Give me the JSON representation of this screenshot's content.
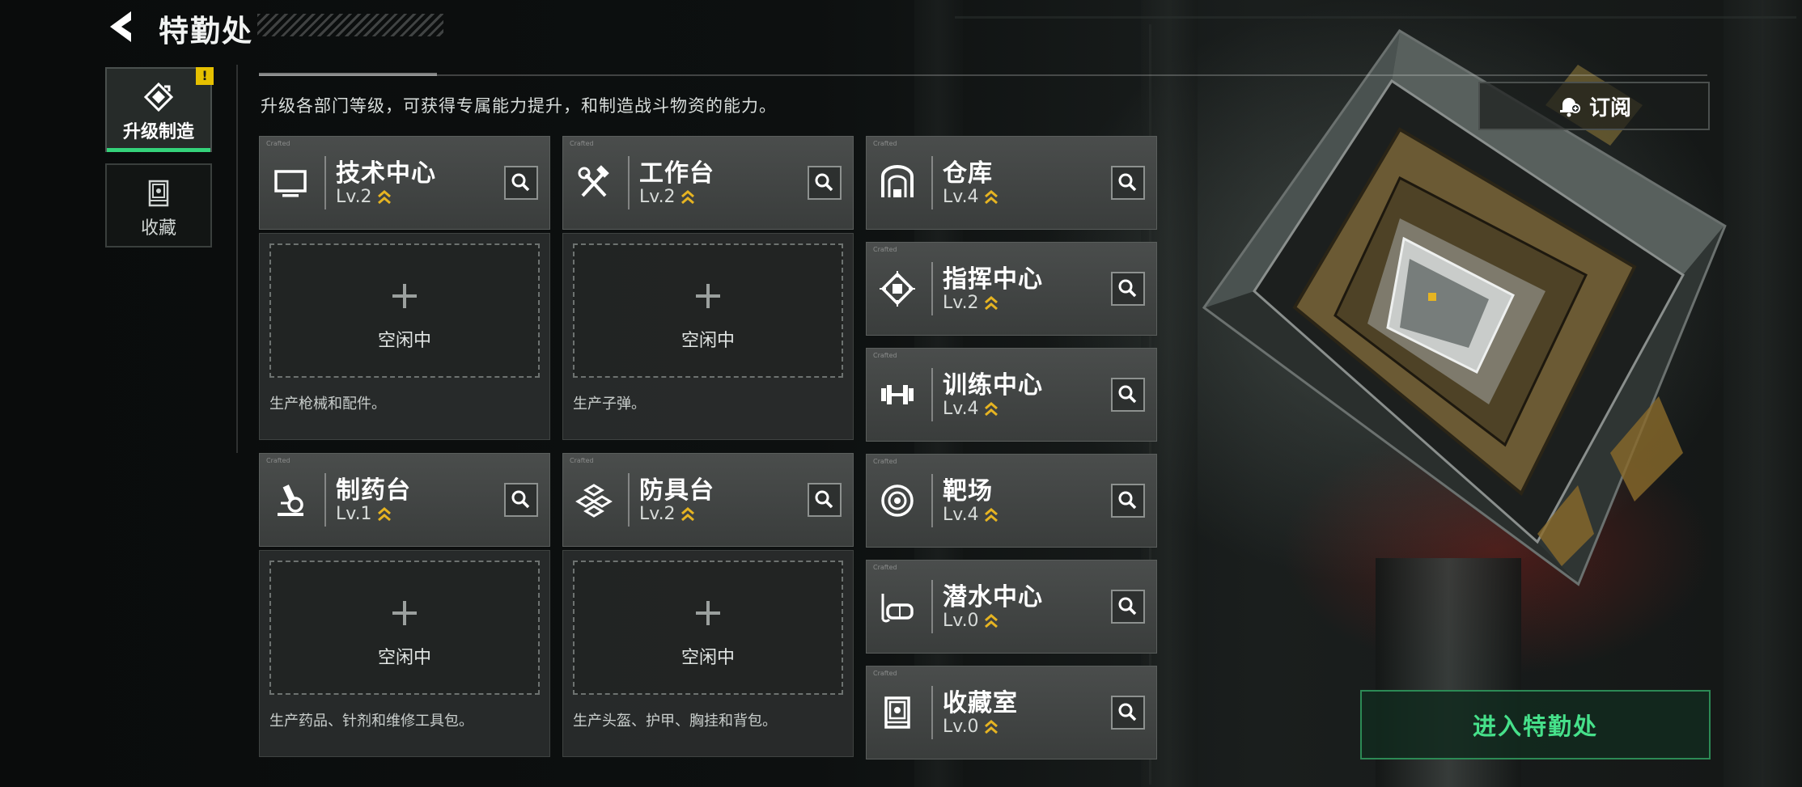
{
  "header": {
    "title": "特勤处"
  },
  "tabs": [
    {
      "label": "升级制造",
      "active": true,
      "alert": "!"
    },
    {
      "label": "收藏",
      "active": false
    }
  ],
  "description": "升级各部门等级，可获得专属能力提升，和制造战斗物资的能力。",
  "subscribe": {
    "label": "订阅"
  },
  "enter": {
    "label": "进入特勤处"
  },
  "idle_label": "空闲中",
  "departments": {
    "tech_center": {
      "name": "技术中心",
      "level": "Lv.2",
      "produce": "生产枪械和配件。"
    },
    "workbench": {
      "name": "工作台",
      "level": "Lv.2",
      "produce": "生产子弹。"
    },
    "pharmacy": {
      "name": "制药台",
      "level": "Lv.1",
      "produce": "生产药品、针剂和维修工具包。"
    },
    "armor": {
      "name": "防具台",
      "level": "Lv.2",
      "produce": "生产头盔、护甲、胸挂和背包。"
    },
    "warehouse": {
      "name": "仓库",
      "level": "Lv.4"
    },
    "command": {
      "name": "指挥中心",
      "level": "Lv.2"
    },
    "training": {
      "name": "训练中心",
      "level": "Lv.4"
    },
    "range": {
      "name": "靶场",
      "level": "Lv.4"
    },
    "diving": {
      "name": "潜水中心",
      "level": "Lv.0"
    },
    "collection": {
      "name": "收藏室",
      "level": "Lv.0"
    }
  },
  "colors": {
    "accent": "#34d27a",
    "level_chevron": "#e6b422",
    "alert": "#e6c000"
  }
}
